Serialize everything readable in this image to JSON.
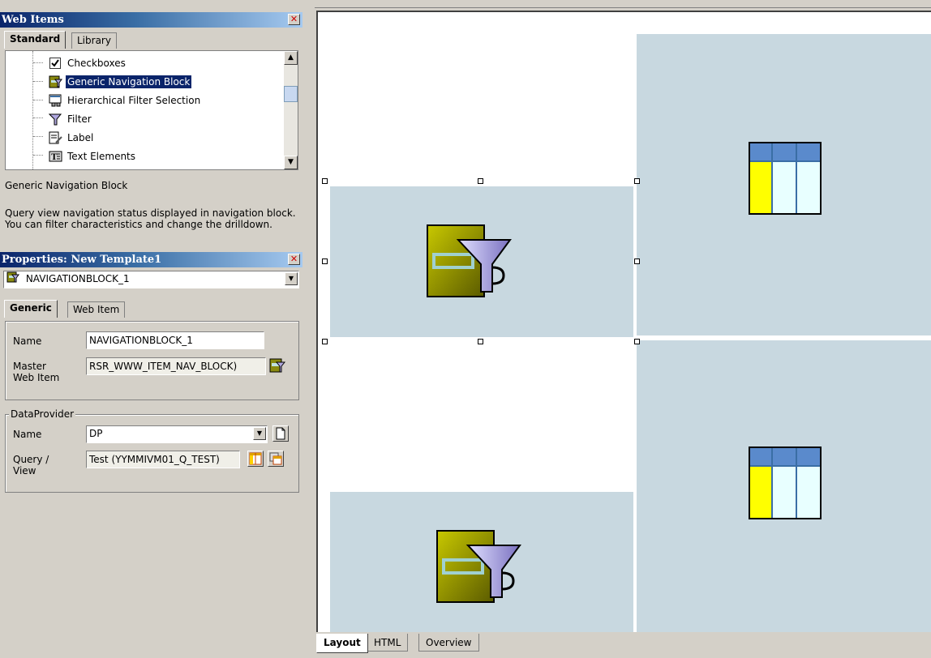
{
  "web_items_pane": {
    "title": "Web Items",
    "tabs": [
      "Standard",
      "Library"
    ],
    "tree_items": [
      {
        "label": "Checkboxes",
        "icon": "checkbox-icon"
      },
      {
        "label": "Generic Navigation Block",
        "icon": "navigation-block-icon",
        "selected": true
      },
      {
        "label": "Hierarchical Filter Selection",
        "icon": "hierarchy-filter-icon"
      },
      {
        "label": "Filter",
        "icon": "filter-icon"
      },
      {
        "label": "Label",
        "icon": "label-icon"
      },
      {
        "label": "Text Elements",
        "icon": "text-elements-icon"
      }
    ],
    "description_title": "Generic Navigation Block",
    "description_line1": "Query view navigation status displayed in navigation block.",
    "description_line2": "You can filter characteristics and change the drilldown."
  },
  "properties_pane": {
    "title": "Properties: New Template1",
    "object_combo": "NAVIGATIONBLOCK_1",
    "tabs": [
      "Generic",
      "Web Item"
    ],
    "name_label": "Name",
    "name_value": "NAVIGATIONBLOCK_1",
    "master_label_1": "Master",
    "master_label_2": "Web Item",
    "master_value": "RSR_WWW_ITEM_NAV_BLOCK)",
    "dataprovider_group": "DataProvider",
    "dp_name_label": "Name",
    "dp_name_value": "DP",
    "query_label_1": "Query /",
    "query_label_2": "View",
    "query_value": "Test (YYMMIVM01_Q_TEST)"
  },
  "editor": {
    "bottom_tabs": [
      "Layout",
      "HTML",
      "Overview"
    ],
    "active_tab": "Layout"
  },
  "colors": {
    "title_bar": "#0a246a",
    "cell_fill": "#c8d8e0",
    "selection": "#0a246a"
  }
}
